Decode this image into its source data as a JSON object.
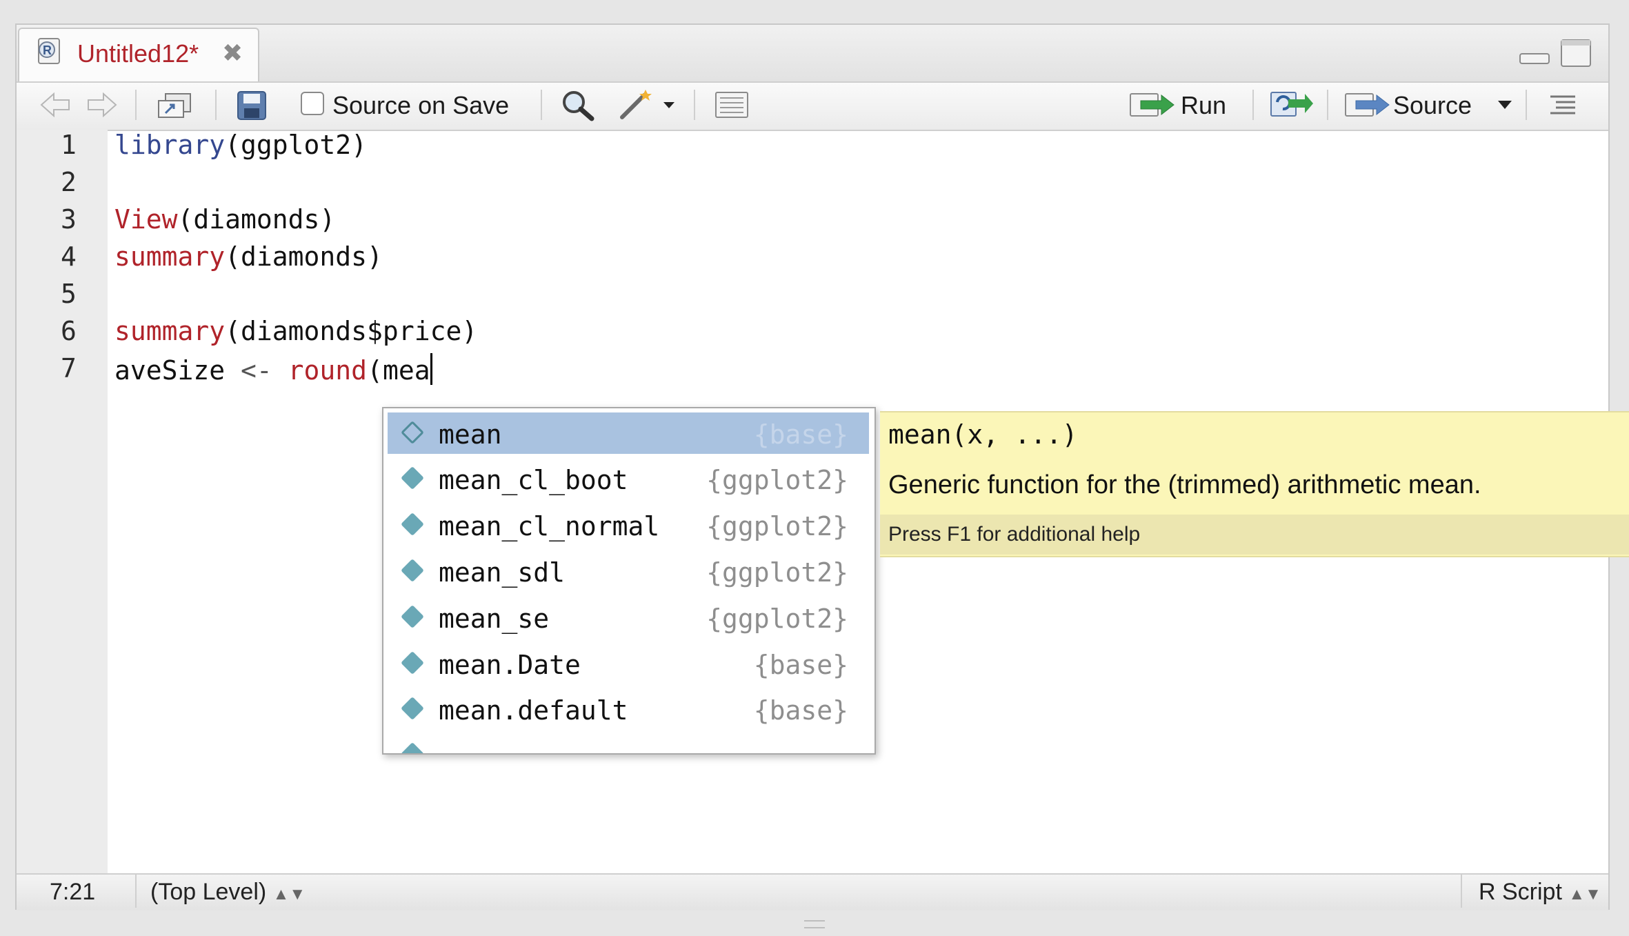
{
  "tab": {
    "title": "Untitled12*",
    "close": "✖"
  },
  "toolbar": {
    "source_on_save": "Source on Save",
    "run": "Run",
    "source": "Source"
  },
  "editor": {
    "line_numbers": [
      "1",
      "2",
      "3",
      "4",
      "5",
      "6",
      "7"
    ],
    "lines": [
      {
        "fn": "library",
        "rest": "(ggplot2)"
      },
      {},
      {
        "fn": "View",
        "rest": "(diamonds)"
      },
      {
        "fn": "summary",
        "rest": "(diamonds)"
      },
      {},
      {
        "fn": "summary",
        "rest": "(diamonds$price)"
      },
      {
        "var": "aveSize ",
        "op": "<-",
        "fn": " round",
        "rest": "(mea"
      }
    ]
  },
  "completion": {
    "items": [
      {
        "name": "mean",
        "pkg": "{base}"
      },
      {
        "name": "mean_cl_boot",
        "pkg": "{ggplot2}"
      },
      {
        "name": "mean_cl_normal",
        "pkg": "{ggplot2}"
      },
      {
        "name": "mean_sdl",
        "pkg": "{ggplot2}"
      },
      {
        "name": "mean_se",
        "pkg": "{ggplot2}"
      },
      {
        "name": "mean.Date",
        "pkg": "{base}"
      },
      {
        "name": "mean.default",
        "pkg": "{base}"
      }
    ],
    "selected_index": 0
  },
  "help": {
    "signature": "mean(x, ...)",
    "description": "Generic function for the (trimmed) arithmetic mean.",
    "footer": "Press F1 for additional help"
  },
  "status": {
    "position": "7:21",
    "scope": "(Top Level)",
    "file_type": "R Script"
  },
  "colors": {
    "keyword_red": "#b0232a",
    "keyword_blue": "#34478f",
    "selection": "#a9c2e0",
    "help_bg": "#fbf6b8"
  },
  "icons": [
    "r-file-icon",
    "back-arrow-icon",
    "forward-arrow-icon",
    "show-in-window-icon",
    "save-icon",
    "search-icon",
    "magic-wand-icon",
    "compile-report-icon",
    "run-icon",
    "rerun-icon",
    "source-icon",
    "outline-icon",
    "minimize-icon",
    "maximize-icon"
  ]
}
